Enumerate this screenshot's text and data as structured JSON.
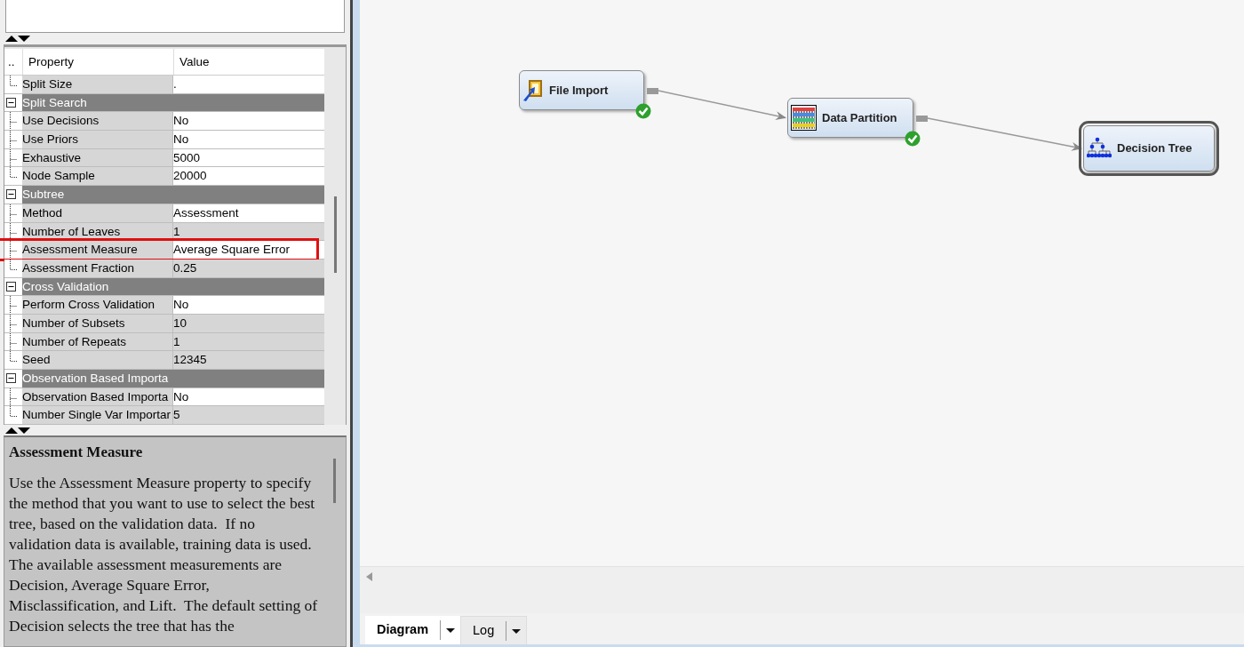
{
  "properties": {
    "columns": [
      "..",
      "Property",
      "Value"
    ],
    "rows": [
      {
        "kind": "property",
        "label": "Split Size",
        "value": ".",
        "editable": true
      },
      {
        "kind": "group",
        "label": "Split Search",
        "expanded": true,
        "children": [
          {
            "label": "Use Decisions",
            "value": "No",
            "editable": true
          },
          {
            "label": "Use Priors",
            "value": "No",
            "editable": true
          },
          {
            "label": "Exhaustive",
            "value": "5000",
            "editable": true
          },
          {
            "label": "Node Sample",
            "value": "20000",
            "editable": true
          }
        ]
      },
      {
        "kind": "group",
        "label": "Subtree",
        "expanded": true,
        "children": [
          {
            "label": "Method",
            "value": "Assessment",
            "editable": true
          },
          {
            "label": "Number of Leaves",
            "value": "1",
            "editable": false
          },
          {
            "label": "Assessment Measure",
            "value": "Average Square Error",
            "editable": true,
            "highlighted": true
          },
          {
            "label": "Assessment Fraction",
            "value": "0.25",
            "editable": false
          }
        ]
      },
      {
        "kind": "group",
        "label": "Cross Validation",
        "expanded": true,
        "children": [
          {
            "label": "Perform Cross Validation",
            "value": "No",
            "editable": true
          },
          {
            "label": "Number of Subsets",
            "value": "10",
            "editable": false
          },
          {
            "label": "Number of Repeats",
            "value": "1",
            "editable": false
          },
          {
            "label": "Seed",
            "value": "12345",
            "editable": false
          }
        ]
      },
      {
        "kind": "group",
        "label": "Observation Based Importa",
        "expanded": true,
        "children": [
          {
            "label": "Observation Based Importa",
            "value": "No",
            "editable": true
          },
          {
            "label": "Number Single Var Importar",
            "value": "5",
            "editable": false
          }
        ]
      }
    ]
  },
  "help": {
    "title": "Assessment Measure",
    "text": "Use the Assessment Measure property to specify the method that you want to use to select the best tree, based on the validation data.  If no validation data is available, training data is used.  The available assessment measurements are Decision, Average Square Error, Misclassification, and Lift.  The default setting of Decision selects the tree that has the"
  },
  "diagram": {
    "nodes": [
      {
        "label": "File Import",
        "completed": true,
        "connected_to_next": true,
        "selected": false
      },
      {
        "label": "Data Partition",
        "completed": true,
        "connected_to_next": true,
        "selected": false
      },
      {
        "label": "Decision Tree",
        "completed": false,
        "connected_to_next": false,
        "selected": true
      }
    ]
  },
  "tabs": [
    {
      "label": "Diagram",
      "selected": true
    },
    {
      "label": "Log",
      "selected": false
    }
  ]
}
